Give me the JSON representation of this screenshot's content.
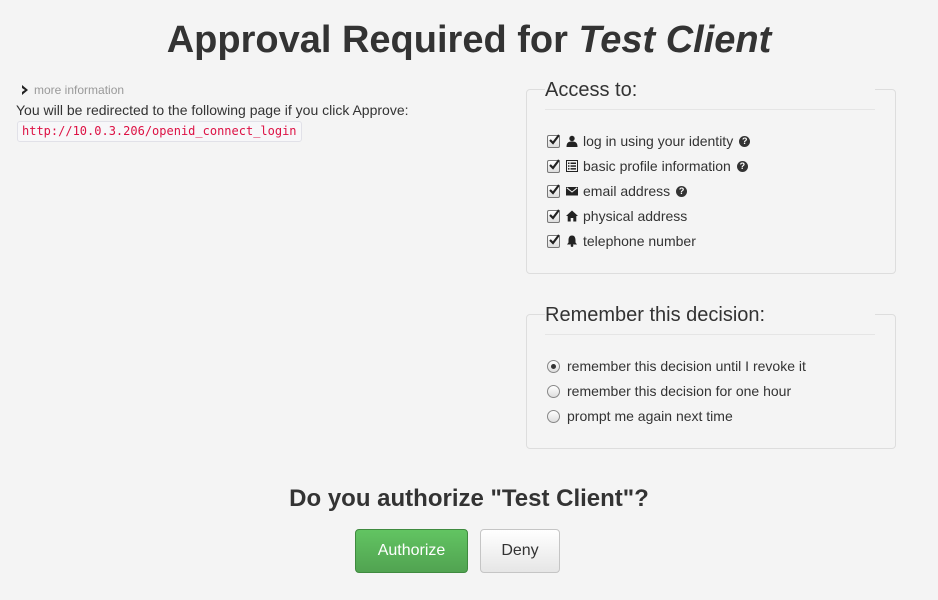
{
  "header": {
    "title_prefix": "Approval Required for",
    "client_name": "Test Client"
  },
  "info": {
    "more_info_label": "more information",
    "redirect_text": "You will be redirected to the following page if you click Approve:",
    "redirect_url": "http://10.0.3.206/openid_connect_login"
  },
  "access": {
    "legend": "Access to:",
    "scopes": [
      {
        "label": "log in using your identity",
        "icon": "user-icon",
        "checked": true,
        "help": true
      },
      {
        "label": "basic profile information",
        "icon": "list-icon",
        "checked": true,
        "help": true
      },
      {
        "label": "email address",
        "icon": "envelope-icon",
        "checked": true,
        "help": true
      },
      {
        "label": "physical address",
        "icon": "home-icon",
        "checked": true,
        "help": false
      },
      {
        "label": "telephone number",
        "icon": "bell-icon",
        "checked": true,
        "help": false
      }
    ]
  },
  "remember": {
    "legend": "Remember this decision:",
    "options": [
      {
        "label": "remember this decision until I revoke it",
        "selected": true
      },
      {
        "label": "remember this decision for one hour",
        "selected": false
      },
      {
        "label": "prompt me again next time",
        "selected": false
      }
    ]
  },
  "prompt": {
    "question": "Do you authorize \"Test Client\"?"
  },
  "actions": {
    "authorize_label": "Authorize",
    "deny_label": "Deny"
  },
  "colors": {
    "authorize_green": "#5bb75b",
    "url_red": "#dd1144",
    "background": "#f4f4f4"
  }
}
